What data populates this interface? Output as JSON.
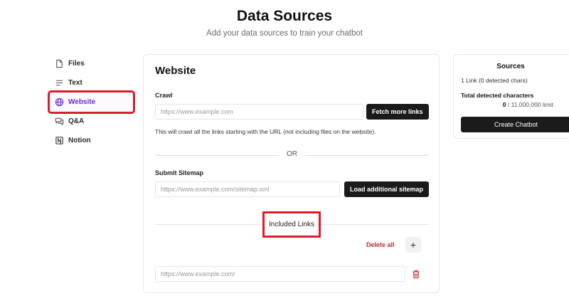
{
  "header": {
    "title": "Data Sources",
    "subtitle": "Add your data sources to train your chatbot"
  },
  "sidebar": {
    "items": [
      {
        "label": "Files",
        "icon": "file-icon"
      },
      {
        "label": "Text",
        "icon": "text-lines-icon"
      },
      {
        "label": "Website",
        "icon": "globe-icon",
        "active": true
      },
      {
        "label": "Q&A",
        "icon": "chat-bubbles-icon"
      },
      {
        "label": "Notion",
        "icon": "notion-icon"
      }
    ]
  },
  "website": {
    "title": "Website",
    "crawl": {
      "label": "Crawl",
      "placeholder": "https://www.example.com",
      "button": "Fetch more links",
      "help": "This will crawl all the links starting with the URL (not including files on the website)."
    },
    "or_text": "OR",
    "sitemap": {
      "label": "Submit Sitemap",
      "placeholder": "https://www.example.com/sitemap.xml",
      "button": "Load additional sitemap"
    },
    "included_links": {
      "heading": "Included Links",
      "delete_all": "Delete all",
      "add_symbol": "+",
      "links": [
        {
          "placeholder": "https://www.example.com/"
        }
      ]
    }
  },
  "sources": {
    "title": "Sources",
    "summary": "1 Link (0 detected chars)",
    "total_label": "Total detected characters",
    "count": "0",
    "limit": "/ 11,000,000 limit",
    "button": "Create Chatbot"
  },
  "colors": {
    "accent": "#6d28d9",
    "highlight": "#dd1c2c",
    "danger": "#c62828",
    "button_dark": "#1b1b1b"
  }
}
